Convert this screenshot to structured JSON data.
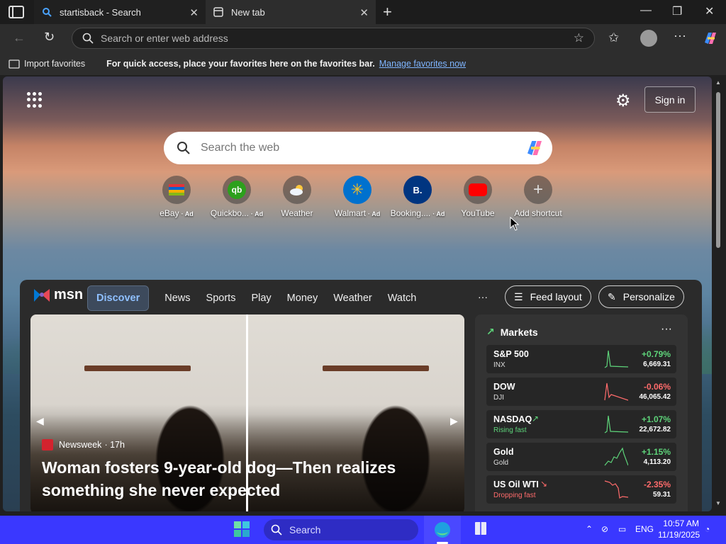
{
  "browser": {
    "tabs": [
      {
        "title": "startisback - Search",
        "close": "✕"
      },
      {
        "title": "New tab",
        "close": "✕"
      }
    ],
    "address_placeholder": "Search or enter web address",
    "favorites_bar": {
      "import_label": "Import favorites",
      "message": "For quick access, place your favorites here on the favorites bar.",
      "link": "Manage favorites now"
    }
  },
  "newtab": {
    "signin_label": "Sign in",
    "search_placeholder": "Search the web",
    "shortcuts": [
      {
        "label": "eBay",
        "ad": "· Ad",
        "color": "#ffffff"
      },
      {
        "label": "Quickbo...",
        "ad": "· Ad",
        "color": "#2ca01c"
      },
      {
        "label": "Weather",
        "ad": "",
        "color": "#4b8fd6"
      },
      {
        "label": "Walmart",
        "ad": "· Ad",
        "color": "#0071ce"
      },
      {
        "label": "Booking....",
        "ad": "· Ad",
        "color": "#003580"
      },
      {
        "label": "YouTube",
        "ad": "",
        "color": "#ff0000"
      },
      {
        "label": "Add shortcut",
        "ad": "",
        "color": "#6b6b6b"
      }
    ]
  },
  "feed": {
    "brand": "msn",
    "nav": [
      "Discover",
      "News",
      "Sports",
      "Play",
      "Money",
      "Weather",
      "Watch"
    ],
    "more": "···",
    "feed_layout_label": "Feed layout",
    "personalize_label": "Personalize",
    "hero": {
      "source": "Newsweek",
      "age": "· 17h",
      "title": "Woman fosters 9-year-old dog—Then realizes something she never expected"
    },
    "markets": {
      "title": "Markets",
      "more": "···",
      "rows": [
        {
          "name": "S&P 500",
          "sub": "INX",
          "pct": "+0.79%",
          "value": "6,669.31",
          "dir": "up"
        },
        {
          "name": "DOW",
          "sub": "DJI",
          "pct": "-0.06%",
          "value": "46,065.42",
          "dir": "down"
        },
        {
          "name": "NASDAQ",
          "sub": "Rising fast",
          "pct": "+1.07%",
          "value": "22,672.82",
          "dir": "up"
        },
        {
          "name": "Gold",
          "sub": "Gold",
          "pct": "+1.15%",
          "value": "4,113.20",
          "dir": "up"
        },
        {
          "name": "US Oil WTI",
          "sub": "Dropping fast",
          "pct": "-2.35%",
          "value": "59.31",
          "dir": "down"
        }
      ]
    }
  },
  "taskbar": {
    "search_label": "Search",
    "lang": "ENG",
    "time": "10:57 AM",
    "date": "11/19/2025"
  }
}
